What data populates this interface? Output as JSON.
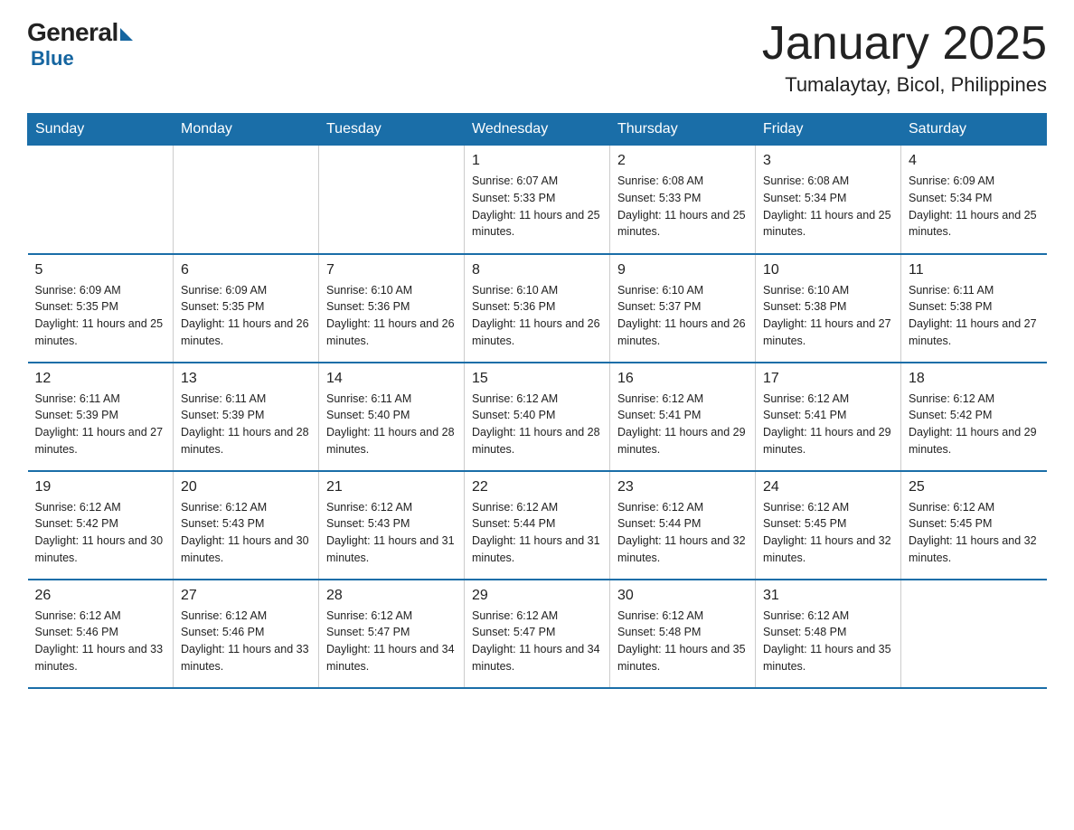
{
  "logo": {
    "general": "General",
    "blue": "Blue"
  },
  "title": "January 2025",
  "subtitle": "Tumalaytay, Bicol, Philippines",
  "days_header": [
    "Sunday",
    "Monday",
    "Tuesday",
    "Wednesday",
    "Thursday",
    "Friday",
    "Saturday"
  ],
  "weeks": [
    [
      {
        "day": "",
        "info": ""
      },
      {
        "day": "",
        "info": ""
      },
      {
        "day": "",
        "info": ""
      },
      {
        "day": "1",
        "info": "Sunrise: 6:07 AM\nSunset: 5:33 PM\nDaylight: 11 hours and 25 minutes."
      },
      {
        "day": "2",
        "info": "Sunrise: 6:08 AM\nSunset: 5:33 PM\nDaylight: 11 hours and 25 minutes."
      },
      {
        "day": "3",
        "info": "Sunrise: 6:08 AM\nSunset: 5:34 PM\nDaylight: 11 hours and 25 minutes."
      },
      {
        "day": "4",
        "info": "Sunrise: 6:09 AM\nSunset: 5:34 PM\nDaylight: 11 hours and 25 minutes."
      }
    ],
    [
      {
        "day": "5",
        "info": "Sunrise: 6:09 AM\nSunset: 5:35 PM\nDaylight: 11 hours and 25 minutes."
      },
      {
        "day": "6",
        "info": "Sunrise: 6:09 AM\nSunset: 5:35 PM\nDaylight: 11 hours and 26 minutes."
      },
      {
        "day": "7",
        "info": "Sunrise: 6:10 AM\nSunset: 5:36 PM\nDaylight: 11 hours and 26 minutes."
      },
      {
        "day": "8",
        "info": "Sunrise: 6:10 AM\nSunset: 5:36 PM\nDaylight: 11 hours and 26 minutes."
      },
      {
        "day": "9",
        "info": "Sunrise: 6:10 AM\nSunset: 5:37 PM\nDaylight: 11 hours and 26 minutes."
      },
      {
        "day": "10",
        "info": "Sunrise: 6:10 AM\nSunset: 5:38 PM\nDaylight: 11 hours and 27 minutes."
      },
      {
        "day": "11",
        "info": "Sunrise: 6:11 AM\nSunset: 5:38 PM\nDaylight: 11 hours and 27 minutes."
      }
    ],
    [
      {
        "day": "12",
        "info": "Sunrise: 6:11 AM\nSunset: 5:39 PM\nDaylight: 11 hours and 27 minutes."
      },
      {
        "day": "13",
        "info": "Sunrise: 6:11 AM\nSunset: 5:39 PM\nDaylight: 11 hours and 28 minutes."
      },
      {
        "day": "14",
        "info": "Sunrise: 6:11 AM\nSunset: 5:40 PM\nDaylight: 11 hours and 28 minutes."
      },
      {
        "day": "15",
        "info": "Sunrise: 6:12 AM\nSunset: 5:40 PM\nDaylight: 11 hours and 28 minutes."
      },
      {
        "day": "16",
        "info": "Sunrise: 6:12 AM\nSunset: 5:41 PM\nDaylight: 11 hours and 29 minutes."
      },
      {
        "day": "17",
        "info": "Sunrise: 6:12 AM\nSunset: 5:41 PM\nDaylight: 11 hours and 29 minutes."
      },
      {
        "day": "18",
        "info": "Sunrise: 6:12 AM\nSunset: 5:42 PM\nDaylight: 11 hours and 29 minutes."
      }
    ],
    [
      {
        "day": "19",
        "info": "Sunrise: 6:12 AM\nSunset: 5:42 PM\nDaylight: 11 hours and 30 minutes."
      },
      {
        "day": "20",
        "info": "Sunrise: 6:12 AM\nSunset: 5:43 PM\nDaylight: 11 hours and 30 minutes."
      },
      {
        "day": "21",
        "info": "Sunrise: 6:12 AM\nSunset: 5:43 PM\nDaylight: 11 hours and 31 minutes."
      },
      {
        "day": "22",
        "info": "Sunrise: 6:12 AM\nSunset: 5:44 PM\nDaylight: 11 hours and 31 minutes."
      },
      {
        "day": "23",
        "info": "Sunrise: 6:12 AM\nSunset: 5:44 PM\nDaylight: 11 hours and 32 minutes."
      },
      {
        "day": "24",
        "info": "Sunrise: 6:12 AM\nSunset: 5:45 PM\nDaylight: 11 hours and 32 minutes."
      },
      {
        "day": "25",
        "info": "Sunrise: 6:12 AM\nSunset: 5:45 PM\nDaylight: 11 hours and 32 minutes."
      }
    ],
    [
      {
        "day": "26",
        "info": "Sunrise: 6:12 AM\nSunset: 5:46 PM\nDaylight: 11 hours and 33 minutes."
      },
      {
        "day": "27",
        "info": "Sunrise: 6:12 AM\nSunset: 5:46 PM\nDaylight: 11 hours and 33 minutes."
      },
      {
        "day": "28",
        "info": "Sunrise: 6:12 AM\nSunset: 5:47 PM\nDaylight: 11 hours and 34 minutes."
      },
      {
        "day": "29",
        "info": "Sunrise: 6:12 AM\nSunset: 5:47 PM\nDaylight: 11 hours and 34 minutes."
      },
      {
        "day": "30",
        "info": "Sunrise: 6:12 AM\nSunset: 5:48 PM\nDaylight: 11 hours and 35 minutes."
      },
      {
        "day": "31",
        "info": "Sunrise: 6:12 AM\nSunset: 5:48 PM\nDaylight: 11 hours and 35 minutes."
      },
      {
        "day": "",
        "info": ""
      }
    ]
  ]
}
